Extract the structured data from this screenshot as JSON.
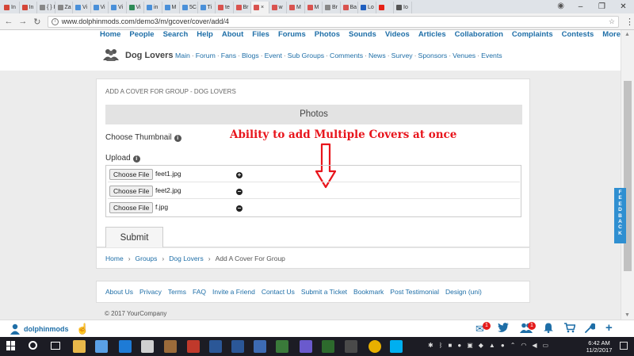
{
  "browser": {
    "tabs": [
      {
        "label": "In",
        "color": "#d44638"
      },
      {
        "label": "In",
        "color": "#d44638"
      },
      {
        "label": "{ } Fl",
        "color": "#888888"
      },
      {
        "label": "Za",
        "color": "#888888"
      },
      {
        "label": "Vi",
        "color": "#4a90d9"
      },
      {
        "label": "Vi",
        "color": "#4a90d9"
      },
      {
        "label": "Vi",
        "color": "#4a90d9"
      },
      {
        "label": "Vi",
        "color": "#2e8b57"
      },
      {
        "label": "in",
        "color": "#4a90d9"
      },
      {
        "label": "M",
        "color": "#4a90d9"
      },
      {
        "label": "5C",
        "color": "#4a90d9"
      },
      {
        "label": "Ti",
        "color": "#4a90d9"
      },
      {
        "label": "te",
        "color": "#d9534f"
      },
      {
        "label": "Br",
        "color": "#d9534f"
      },
      {
        "label": "×",
        "color": "#d9534f"
      },
      {
        "label": "w",
        "color": "#d9534f"
      },
      {
        "label": "M",
        "color": "#d9534f"
      },
      {
        "label": "M",
        "color": "#d9534f"
      },
      {
        "label": "Br",
        "color": "#888888"
      },
      {
        "label": "Ba",
        "color": "#d9534f"
      },
      {
        "label": "Lo",
        "color": "#1f5fbf"
      },
      {
        "label": "",
        "color": "#e62117"
      },
      {
        "label": "Io",
        "color": "#555555"
      }
    ],
    "active_tab_index": 14,
    "window_controls": [
      "–",
      "❐",
      "✕"
    ],
    "url": "www.dolphinmods.com/demo3/m/gcover/cover/add/4"
  },
  "topnav": [
    "Home",
    "People",
    "Search",
    "Help",
    "About",
    "Files",
    "Forums",
    "Photos",
    "Sounds",
    "Videos",
    "Articles",
    "Collaboration",
    "Complaints",
    "Contests",
    "More"
  ],
  "group": {
    "name": "Dog Lovers",
    "links": [
      "Main",
      "Forum",
      "Fans",
      "Blogs",
      "Event",
      "Sub Groups",
      "Comments",
      "News",
      "Survey",
      "Sponsors",
      "Venues",
      "Events"
    ],
    "separator": "·"
  },
  "form": {
    "heading": "ADD A COVER FOR GROUP - DOG LOVERS",
    "section_title": "Photos",
    "thumbnail_label": "Choose Thumbnail",
    "upload_label": "Upload",
    "info_glyph": "i",
    "annotation": "Ability to add Multiple Covers at once",
    "annotation_color": "#e8151c",
    "file_button_label": "Choose File",
    "files": [
      {
        "name": "feet1.jpg",
        "action": "+",
        "action_icon": "add-icon"
      },
      {
        "name": "feet2.jpg",
        "action": "−",
        "action_icon": "remove-icon"
      },
      {
        "name": "f.jpg",
        "action": "−",
        "action_icon": "remove-icon"
      }
    ],
    "submit_label": "Submit"
  },
  "breadcrumb": [
    "Home",
    "Groups",
    "Dog Lovers",
    "Add A Cover For Group"
  ],
  "breadcrumb_separator": "›",
  "footer": {
    "links": [
      "About Us",
      "Privacy",
      "Terms",
      "FAQ",
      "Invite a Friend",
      "Contact Us",
      "Submit a Ticket",
      "Bookmark",
      "Post Testimonial",
      "Design (uni)"
    ],
    "copyright": "© 2017 YourCompany"
  },
  "feedback_label": "FEEDBACK",
  "bottom_bar": {
    "username": "dolphinmods",
    "messages_badge": "1",
    "friends_badge": "1"
  },
  "taskbar": {
    "time": "6:42 AM",
    "date": "11/2/2017"
  },
  "colors": {
    "link": "#1e6ea7",
    "accent_red": "#e8151c"
  }
}
